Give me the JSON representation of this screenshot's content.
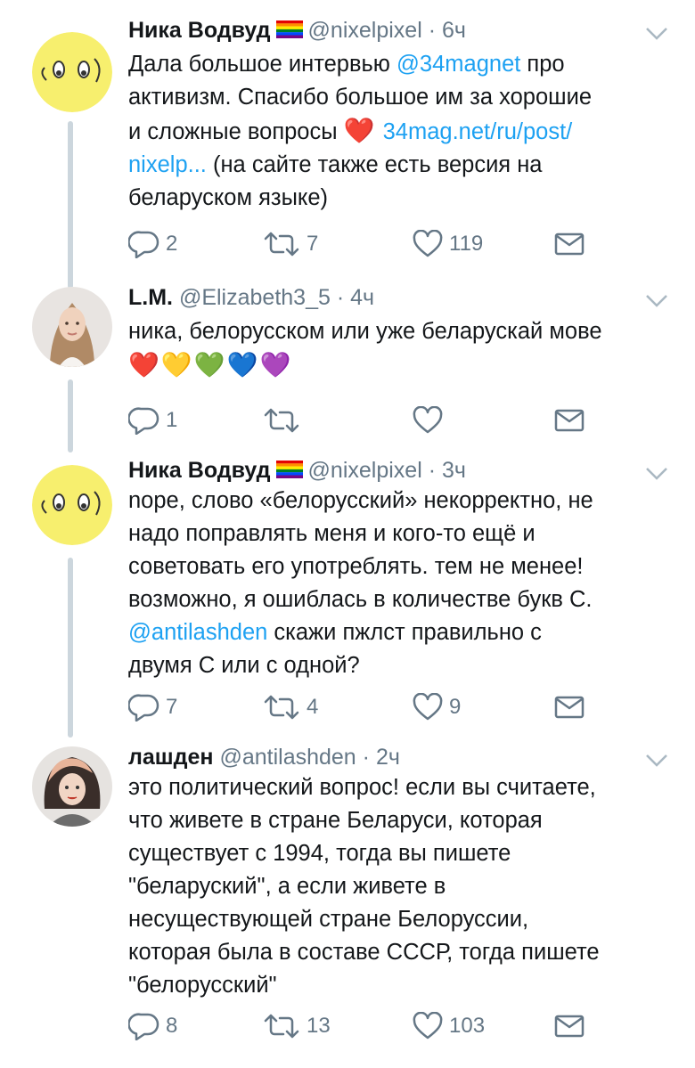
{
  "tweets": [
    {
      "name": "Ника Водвуд",
      "handle": "@nixelpixel",
      "time": "6ч",
      "lines": [
        [
          {
            "t": "Дала большое интервью "
          },
          {
            "t": "@34magnet",
            "link": true
          },
          {
            "t": " про"
          }
        ],
        [
          {
            "t": "активизм. Спасибо большое им за хорошие"
          }
        ],
        [
          {
            "t": "и сложные вопросы "
          },
          {
            "t": "❤️",
            "emoji": true
          },
          {
            "t": " "
          },
          {
            "t": "34mag.net/ru/post/",
            "link": true
          }
        ],
        [
          {
            "t": "nixelp...",
            "link": true
          },
          {
            "t": " (на сайте также есть версия на"
          }
        ],
        [
          {
            "t": "беларуском языке)"
          }
        ]
      ],
      "replies": "2",
      "retweets": "7",
      "likes": "119"
    },
    {
      "name": "L.M.",
      "handle": "@Elizabeth3_5",
      "time": "4ч",
      "lines": [
        [
          {
            "t": "ника, белорусском или уже беларускай мове"
          }
        ],
        [
          {
            "t": "❤️💛💚💙💜",
            "emoji": true
          }
        ]
      ],
      "replies": "1",
      "retweets": "",
      "likes": ""
    },
    {
      "name": "Ника Водвуд",
      "handle": "@nixelpixel",
      "time": "3ч",
      "lines": [
        [
          {
            "t": "nope, слово «белорусский» некорректно, не"
          }
        ],
        [
          {
            "t": "надо поправлять меня и кого-то ещё и"
          }
        ],
        [
          {
            "t": "советовать его употреблять. тем не менее!"
          }
        ],
        [
          {
            "t": "возможно, я ошиблась в количестве букв С."
          }
        ],
        [
          {
            "t": "@antilashden",
            "link": true
          },
          {
            "t": " скажи пжлст правильно с"
          }
        ],
        [
          {
            "t": "двумя С или с одной?"
          }
        ]
      ],
      "replies": "7",
      "retweets": "4",
      "likes": "9"
    },
    {
      "name": "лашден",
      "handle": "@antilashden",
      "time": "2ч",
      "lines": [
        [
          {
            "t": "это политический вопрос! если вы считаете,"
          }
        ],
        [
          {
            "t": "что живете в стране Беларуси, которая"
          }
        ],
        [
          {
            "t": "существует с 1994, тогда вы пишете"
          }
        ],
        [
          {
            "t": "\"беларуский\", а если живете в"
          }
        ],
        [
          {
            "t": "несуществующей стране Белоруссии,"
          }
        ],
        [
          {
            "t": "которая была в составе СССР, тогда пишете"
          }
        ],
        [
          {
            "t": "\"белорусский\""
          }
        ]
      ],
      "replies": "8",
      "retweets": "13",
      "likes": "103"
    }
  ],
  "icons": {
    "reply": "reply-icon",
    "retweet": "retweet-icon",
    "like": "heart-icon",
    "dm": "envelope-icon",
    "menu": "chevron-down-icon"
  },
  "colors": {
    "link": "#1da1f2",
    "muted": "#657786",
    "text": "#14171a",
    "thread_line": "#ccd6dd"
  }
}
